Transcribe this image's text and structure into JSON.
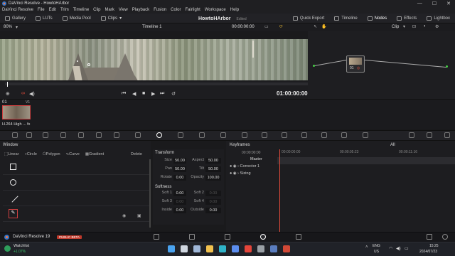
{
  "window": {
    "title": "DaVinci Resolve - HowtoHArbor",
    "min": "—",
    "max": "☐",
    "close": "✕"
  },
  "menu": [
    "DaVinci Resolve",
    "File",
    "Edit",
    "Trim",
    "Timeline",
    "Clip",
    "Mark",
    "View",
    "Playback",
    "Fusion",
    "Color",
    "Fairlight",
    "Workspace",
    "Help"
  ],
  "toolbar": {
    "left": [
      "Gallery",
      "LUTs",
      "Media Pool",
      "Clips"
    ],
    "project_name": "HowtoHArbor",
    "project_status": "Edited",
    "right": [
      "Quick Export",
      "Timeline",
      "Nodes",
      "Effects",
      "Lightbox"
    ],
    "active": "Nodes"
  },
  "viewer_header": {
    "zoom": "80%",
    "timeline": "Timeline 1",
    "timecode": "00:00:00:00",
    "clip_mode": "Clip"
  },
  "transport": {
    "timecode": "01:00:00:00"
  },
  "nodes": [
    {
      "label": "01"
    }
  ],
  "clips": [
    {
      "index": "01",
      "track": "V1",
      "name": "H.264 High ... fx"
    }
  ],
  "window_panel": {
    "title": "Window",
    "tabs": [
      "Linear",
      "Circle",
      "Polygon",
      "Curve",
      "Gradient"
    ],
    "delete_label": "Delete"
  },
  "transform": {
    "title": "Transform",
    "fields": [
      {
        "label": "Size",
        "value": "50.00",
        "label2": "Aspect",
        "value2": "50.00"
      },
      {
        "label": "Pan",
        "value": "50.00",
        "label2": "Tilt",
        "value2": "50.00"
      },
      {
        "label": "Rotate",
        "value": "0.00",
        "label2": "Opacity",
        "value2": "100.00"
      }
    ],
    "softness_title": "Softness",
    "softness": [
      {
        "label": "Soft 1",
        "value": "0.00",
        "label2": "Soft 2",
        "value2": "0.00"
      },
      {
        "label": "Soft 3",
        "value": "0.00",
        "label2": "Soft 4",
        "value2": "0.00"
      },
      {
        "label": "Inside",
        "value": "0.00",
        "label2": "Outside",
        "value2": "0.00"
      }
    ]
  },
  "keyframes": {
    "title": "Keyframes",
    "filter": "All",
    "timecodes": [
      "00:00:00:00",
      "00:00:00:00",
      "00:00:05:23",
      "00:00:11:16"
    ],
    "tracks": [
      "Master",
      "Corrector 1",
      "Sizing"
    ]
  },
  "pagebar": {
    "app": "DaVinci Resolve 19",
    "badge": "PUBLIC BETA"
  },
  "taskbar": {
    "watchlist": "Watchlist",
    "change": "+1.07%",
    "lang": "ENG",
    "region": "US",
    "time": "15:25",
    "date": "2024/07/23"
  },
  "colors": {
    "accent_red": "#d04040",
    "badge_red": "#c0392b",
    "playhead": "#e04a3a"
  }
}
